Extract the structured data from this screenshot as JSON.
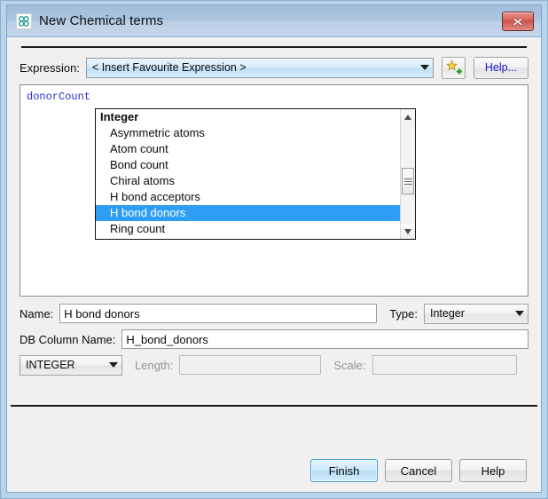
{
  "window": {
    "title": "New Chemical terms",
    "app_icon": "molecule-icon",
    "close_label": "x"
  },
  "expression": {
    "label": "Expression:",
    "combo_value": "< Insert Favourite Expression >",
    "add_favourite_icon": "star-plus-icon",
    "help_label": "Help...",
    "editor_text": "donorCount"
  },
  "dropdown": {
    "items": [
      {
        "label": "Integer",
        "type": "group",
        "selected": false
      },
      {
        "label": "Asymmetric atoms",
        "type": "child",
        "selected": false
      },
      {
        "label": "Atom count",
        "type": "child",
        "selected": false
      },
      {
        "label": "Bond count",
        "type": "child",
        "selected": false
      },
      {
        "label": "Chiral atoms",
        "type": "child",
        "selected": false
      },
      {
        "label": "H bond acceptors",
        "type": "child",
        "selected": false
      },
      {
        "label": "H bond donors",
        "type": "child",
        "selected": true
      },
      {
        "label": "Ring count",
        "type": "child",
        "selected": false
      }
    ],
    "scroll_up_icon": "caret-up-icon",
    "scroll_down_icon": "caret-down-icon",
    "highlight_color": "#2e9ef4"
  },
  "form": {
    "name_label": "Name:",
    "name_value": "H bond donors",
    "type_label": "Type:",
    "type_value": "Integer",
    "db_column_label": "DB Column Name:",
    "db_column_value": "H_bond_donors",
    "sql_type_value": "INTEGER",
    "length_label": "Length:",
    "length_value": "",
    "scale_label": "Scale:",
    "scale_value": ""
  },
  "footer": {
    "finish_label": "Finish",
    "cancel_label": "Cancel",
    "help_label": "Help"
  }
}
